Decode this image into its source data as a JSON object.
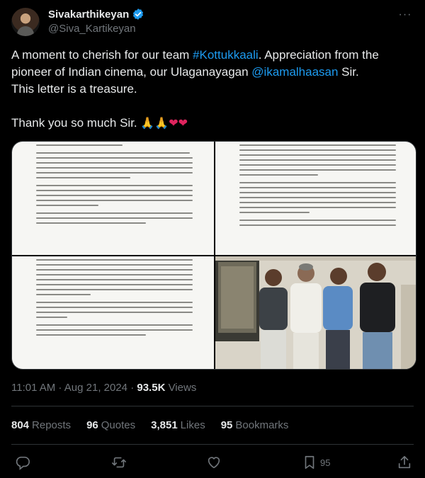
{
  "author": {
    "display_name": "Sivakarthikeyan",
    "handle": "@Siva_Kartikeyan",
    "verified": true
  },
  "tweet": {
    "line1_pre": "A moment to cherish for our team ",
    "hashtag": "#Kottukkaali",
    "line1_post": ". Appreciation from the pioneer of Indian cinema, our Ulaganayagan ",
    "mention": "@ikamalhaasan",
    "line1_end": " Sir.",
    "line2": "This letter is a treasure.",
    "line3": "Thank you so much Sir. ",
    "emojis": "🙏🙏"
  },
  "media": {
    "icon": "photo-grid",
    "count": 4
  },
  "meta": {
    "time": "11:01 AM",
    "date": "Aug 21, 2024",
    "views_count": "93.5K",
    "views_label": "Views"
  },
  "stats": {
    "reposts_count": "804",
    "reposts_label": "Reposts",
    "quotes_count": "96",
    "quotes_label": "Quotes",
    "likes_count": "3,851",
    "likes_label": "Likes",
    "bookmarks_count": "95",
    "bookmarks_label": "Bookmarks"
  },
  "actions": {
    "bookmark_count": "95"
  },
  "colors": {
    "background": "#000000",
    "text": "#e7e9ea",
    "muted": "#71767b",
    "link": "#1d9bf0",
    "divider": "#2f3336",
    "heart": "#e0245e"
  }
}
